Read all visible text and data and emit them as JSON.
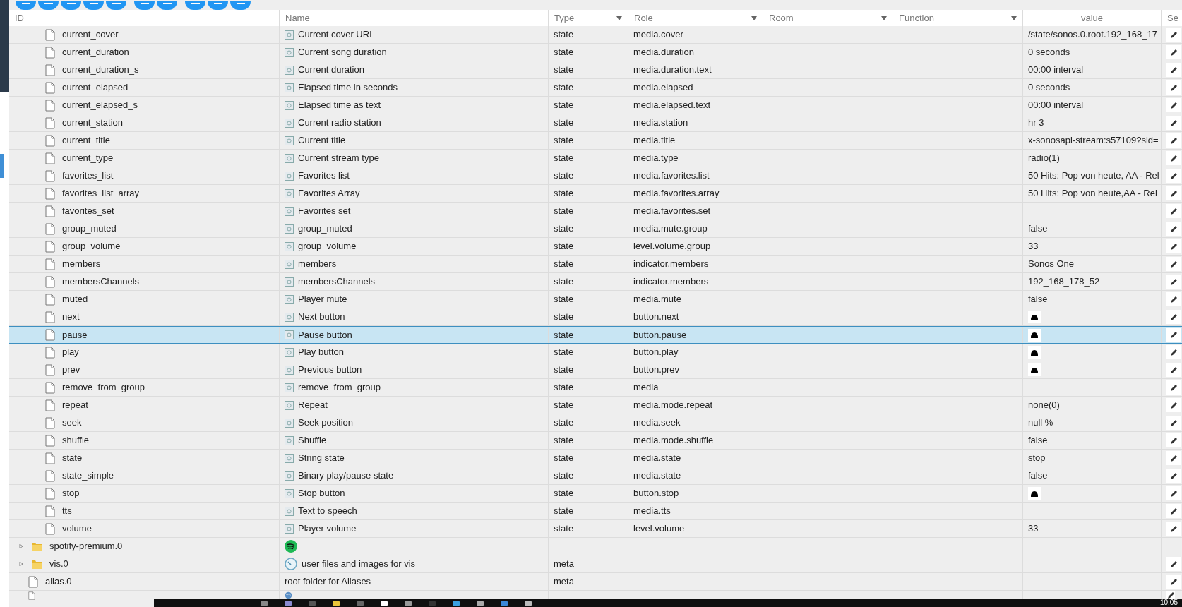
{
  "table": {
    "columns": [
      {
        "label": "ID",
        "filter": false
      },
      {
        "label": "Name",
        "filter": false
      },
      {
        "label": "Type",
        "filter": true
      },
      {
        "label": "Role",
        "filter": true
      },
      {
        "label": "Room",
        "filter": true
      },
      {
        "label": "Function",
        "filter": true
      },
      {
        "label": "value",
        "filter": false
      },
      {
        "label": "Se"
      }
    ],
    "tree": [
      {
        "children": [
          {
            "kind": "state",
            "id": "current_cover",
            "name": "Current cover URL",
            "type": "state",
            "role": "media.cover",
            "value": "/state/sonos.0.root.192_168_17",
            "value_button": false,
            "editable": true,
            "selected": false
          },
          {
            "kind": "state",
            "id": "current_duration",
            "name": "Current song duration",
            "type": "state",
            "role": "media.duration",
            "value": "0 seconds",
            "value_button": false,
            "editable": true,
            "selected": false
          },
          {
            "kind": "state",
            "id": "current_duration_s",
            "name": "Current duration",
            "type": "state",
            "role": "media.duration.text",
            "value": "00:00 interval",
            "value_button": false,
            "editable": true,
            "selected": false
          },
          {
            "kind": "state",
            "id": "current_elapsed",
            "name": "Elapsed time in seconds",
            "type": "state",
            "role": "media.elapsed",
            "value": "0 seconds",
            "value_button": false,
            "editable": true,
            "selected": false
          },
          {
            "kind": "state",
            "id": "current_elapsed_s",
            "name": "Elapsed time as text",
            "type": "state",
            "role": "media.elapsed.text",
            "value": "00:00 interval",
            "value_button": false,
            "editable": true,
            "selected": false
          },
          {
            "kind": "state",
            "id": "current_station",
            "name": "Current radio station",
            "type": "state",
            "role": "media.station",
            "value": "hr 3",
            "value_button": false,
            "editable": true,
            "selected": false
          },
          {
            "kind": "state",
            "id": "current_title",
            "name": "Current title",
            "type": "state",
            "role": "media.title",
            "value": "x-sonosapi-stream:s57109?sid=",
            "value_button": false,
            "editable": true,
            "selected": false
          },
          {
            "kind": "state",
            "id": "current_type",
            "name": "Current stream type",
            "type": "state",
            "role": "media.type",
            "value": "radio(1)",
            "value_button": false,
            "editable": true,
            "selected": false
          },
          {
            "kind": "state",
            "id": "favorites_list",
            "name": "Favorites list",
            "type": "state",
            "role": "media.favorites.list",
            "value": "50 Hits: Pop von heute, AA - Rel",
            "value_button": false,
            "editable": true,
            "selected": false
          },
          {
            "kind": "state",
            "id": "favorites_list_array",
            "name": "Favorites Array",
            "type": "state",
            "role": "media.favorites.array",
            "value": "50 Hits: Pop von heute,AA - Rel",
            "value_button": false,
            "editable": true,
            "selected": false
          },
          {
            "kind": "state",
            "id": "favorites_set",
            "name": "Favorites set",
            "type": "state",
            "role": "media.favorites.set",
            "value_button": false,
            "editable": true,
            "selected": false
          },
          {
            "kind": "state",
            "id": "group_muted",
            "name": "group_muted",
            "type": "state",
            "role": "media.mute.group",
            "value": "false",
            "value_button": false,
            "editable": true,
            "selected": false
          },
          {
            "kind": "state",
            "id": "group_volume",
            "name": "group_volume",
            "type": "state",
            "role": "level.volume.group",
            "value": "33",
            "value_button": false,
            "editable": true,
            "selected": false
          },
          {
            "kind": "state",
            "id": "members",
            "name": "members",
            "type": "state",
            "role": "indicator.members",
            "value": "Sonos One",
            "value_button": false,
            "editable": true,
            "selected": false
          },
          {
            "kind": "state",
            "id": "membersChannels",
            "name": "membersChannels",
            "type": "state",
            "role": "indicator.members",
            "value": "192_168_178_52",
            "value_button": false,
            "editable": true,
            "selected": false
          },
          {
            "kind": "state",
            "id": "muted",
            "name": "Player mute",
            "type": "state",
            "role": "media.mute",
            "value": "false",
            "value_button": false,
            "editable": true,
            "selected": false
          },
          {
            "kind": "state",
            "id": "next",
            "name": "Next button",
            "type": "state",
            "role": "button.next",
            "value_button": true,
            "editable": true,
            "selected": false
          },
          {
            "kind": "state",
            "id": "pause",
            "name": "Pause button",
            "type": "state",
            "role": "button.pause",
            "value_button": true,
            "editable": true,
            "selected": true
          },
          {
            "kind": "state",
            "id": "play",
            "name": "Play button",
            "type": "state",
            "role": "button.play",
            "value_button": true,
            "editable": true,
            "selected": false
          },
          {
            "kind": "state",
            "id": "prev",
            "name": "Previous button",
            "type": "state",
            "role": "button.prev",
            "value_button": true,
            "editable": true,
            "selected": false
          },
          {
            "kind": "state",
            "id": "remove_from_group",
            "name": "remove_from_group",
            "type": "state",
            "role": "media",
            "value_button": false,
            "editable": true,
            "selected": false
          },
          {
            "kind": "state",
            "id": "repeat",
            "name": "Repeat",
            "type": "state",
            "role": "media.mode.repeat",
            "value": "none(0)",
            "value_button": false,
            "editable": true,
            "selected": false
          },
          {
            "kind": "state",
            "id": "seek",
            "name": "Seek position",
            "type": "state",
            "role": "media.seek",
            "value": "null %",
            "value_button": false,
            "editable": true,
            "selected": false
          },
          {
            "kind": "state",
            "id": "shuffle",
            "name": "Shuffle",
            "type": "state",
            "role": "media.mode.shuffle",
            "value": "false",
            "value_button": false,
            "editable": true,
            "selected": false
          },
          {
            "kind": "state",
            "id": "state",
            "name": "String state",
            "type": "state",
            "role": "media.state",
            "value": "stop",
            "value_button": false,
            "editable": true,
            "selected": false
          },
          {
            "kind": "state",
            "id": "state_simple",
            "name": "Binary play/pause state",
            "type": "state",
            "role": "media.state",
            "value": "false",
            "value_button": false,
            "editable": true,
            "selected": false
          },
          {
            "kind": "state",
            "id": "stop",
            "name": "Stop button",
            "type": "state",
            "role": "button.stop",
            "value_button": true,
            "editable": true,
            "selected": false
          },
          {
            "kind": "state",
            "id": "tts",
            "name": "Text to speech",
            "type": "state",
            "role": "media.tts",
            "value_button": false,
            "editable": true,
            "selected": false
          },
          {
            "kind": "state",
            "id": "volume",
            "name": "Player volume",
            "type": "state",
            "role": "level.volume",
            "value": "33",
            "value_button": false,
            "editable": true,
            "selected": false
          }
        ]
      },
      {
        "kind": "spotify",
        "id": "spotify-premium.0",
        "expanded": false,
        "value_button": false,
        "editable": false,
        "selected": false
      },
      {
        "kind": "vis",
        "id": "vis.0",
        "expanded": false,
        "name": "user files and images for vis",
        "type": "meta",
        "value_button": false,
        "editable": true,
        "selected": false
      },
      {
        "kind": "alias",
        "id": "alias.0",
        "name": "root folder for Aliases",
        "type": "meta",
        "value_button": false,
        "editable": true,
        "selected": false
      },
      {
        "kind": "web",
        "value_button": false,
        "editable": true,
        "selected": false
      }
    ]
  },
  "taskbar": {
    "clock": "10:05"
  }
}
